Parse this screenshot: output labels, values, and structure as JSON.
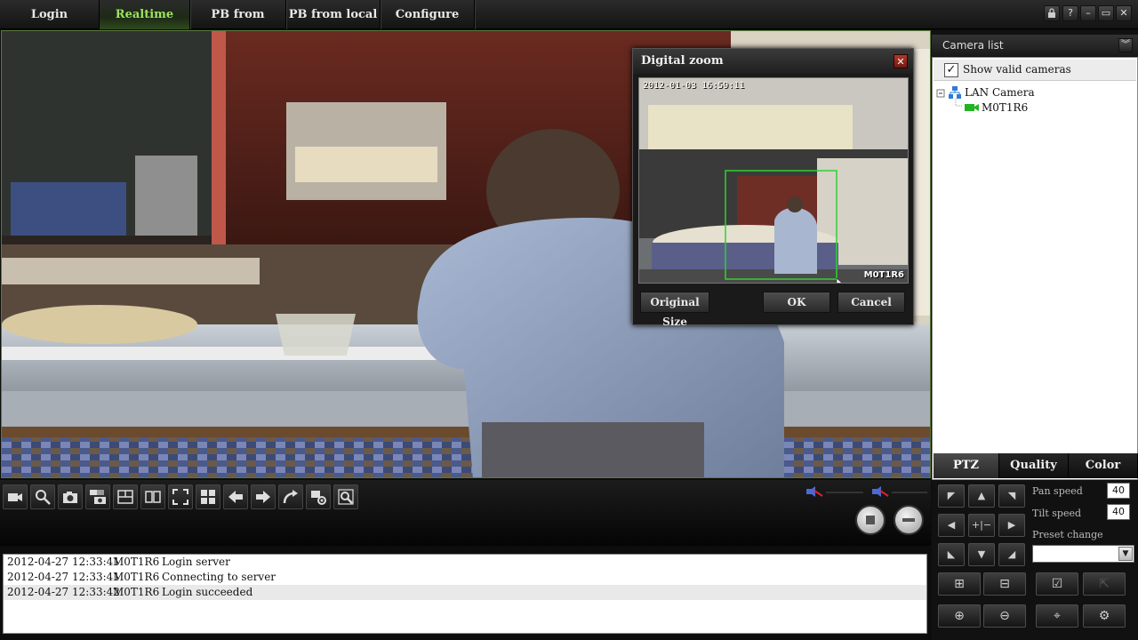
{
  "menu": {
    "items": [
      {
        "label": "Login"
      },
      {
        "label": "Realtime"
      },
      {
        "label": "PB from server"
      },
      {
        "label": "PB from local"
      },
      {
        "label": "Configure"
      }
    ],
    "active": "Realtime",
    "window_buttons": [
      "lock-icon",
      "help-icon",
      "minimize-icon",
      "restore-icon",
      "close-icon"
    ]
  },
  "digital_zoom": {
    "title": "Digital zoom",
    "timestamp": "2012-01-03 16:59:11",
    "camera_label": "M0T1R6",
    "buttons": {
      "original": "Original Size",
      "ok": "OK",
      "cancel": "Cancel"
    }
  },
  "toolbar": {
    "icons": [
      "video-record-icon",
      "zoom-icon",
      "snapshot-icon",
      "multi-snapshot-icon",
      "layout-split-icon",
      "layout-dual-icon",
      "fullscreen-icon",
      "grid-icon",
      "previous-icon",
      "next-icon",
      "redo-icon",
      "settings-icon",
      "digital-zoom-icon"
    ]
  },
  "log": {
    "rows": [
      {
        "time": "2012-04-27 12:33:41",
        "camera": "M0T1R6",
        "message": "Login server"
      },
      {
        "time": "2012-04-27 12:33:41",
        "camera": "M0T1R6",
        "message": "Connecting to server"
      },
      {
        "time": "2012-04-27 12:33:42",
        "camera": "M0T1R6",
        "message": "Login succeeded"
      }
    ]
  },
  "camera_list": {
    "title": "Camera list",
    "show_valid_label": "Show valid cameras",
    "show_valid_checked": true,
    "tree": {
      "group": "LAN Camera",
      "camera": "M0T1R6"
    }
  },
  "ptz": {
    "tabs": [
      {
        "label": "PTZ"
      },
      {
        "label": "Quality"
      },
      {
        "label": "Color"
      }
    ],
    "active_tab": "PTZ",
    "pan_speed_label": "Pan speed",
    "pan_speed": "40",
    "tilt_speed_label": "Tilt speed",
    "tilt_speed": "40",
    "preset_label": "Preset change",
    "preset_value": ""
  },
  "colors": {
    "accent_green": "#9fe25f",
    "zoom_rect": "#2fd12f",
    "tree_camera": "#22b322"
  }
}
